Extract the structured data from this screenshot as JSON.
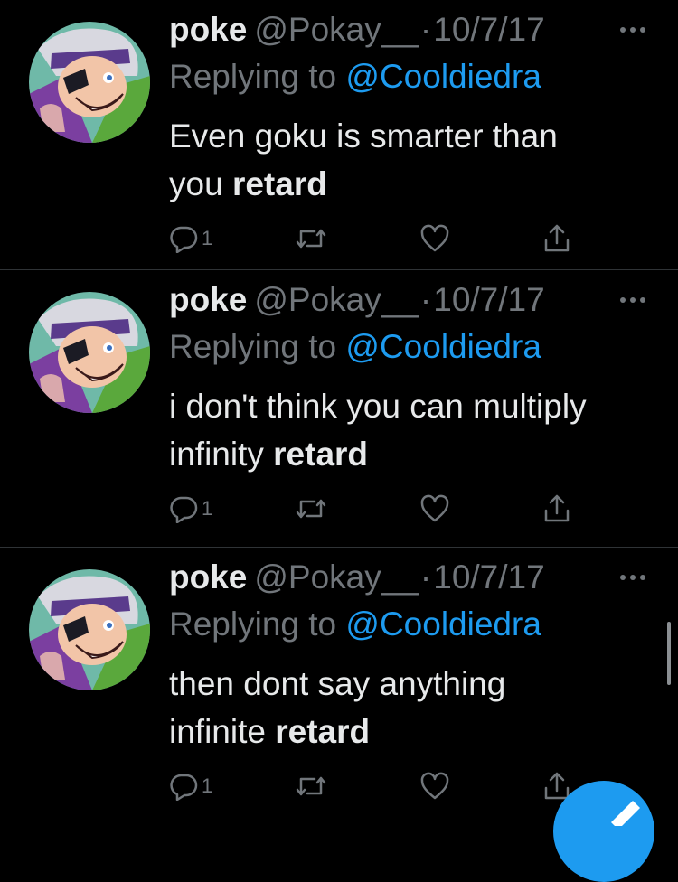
{
  "tweets": [
    {
      "name": "poke",
      "handle": "@Pokay__",
      "separator": "·",
      "date": "10/7/17",
      "replying_prefix": "Replying to ",
      "replying_to": "@Cooldiedra",
      "text_line1": "Even goku is smarter than",
      "text_line2": "you ",
      "text_bold": "retard",
      "reply_count": "1"
    },
    {
      "name": "poke",
      "handle": "@Pokay__",
      "separator": "·",
      "date": "10/7/17",
      "replying_prefix": "Replying to ",
      "replying_to": "@Cooldiedra",
      "text_line1": "i don't think you can multiply",
      "text_line2": "infinity ",
      "text_bold": "retard",
      "reply_count": "1"
    },
    {
      "name": "poke",
      "handle": "@Pokay__",
      "separator": "·",
      "date": "10/7/17",
      "replying_prefix": "Replying to ",
      "replying_to": "@Cooldiedra",
      "text_line1": "then dont say anything",
      "text_line2": "infinite ",
      "text_bold": "retard",
      "reply_count": "1"
    }
  ],
  "icons": {
    "more": "more-horizontal-icon",
    "reply": "reply-bubble-icon",
    "retweet": "retweet-icon",
    "like": "heart-icon",
    "share": "share-icon",
    "compose": "compose-icon"
  },
  "colors": {
    "background": "#000000",
    "primary_text": "#e7e9ea",
    "secondary_text": "#71767b",
    "accent": "#1d9bf0",
    "divider": "#2f3336"
  }
}
